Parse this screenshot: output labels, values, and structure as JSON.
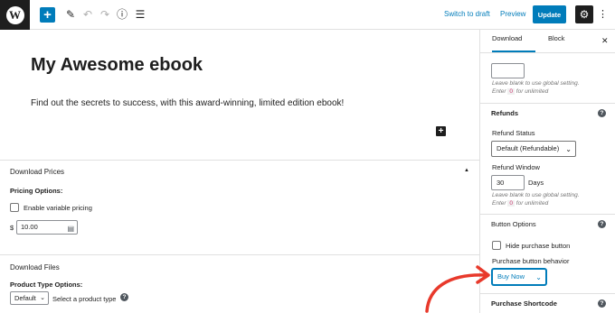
{
  "toolbar": {
    "logo_letter": "W",
    "switch_draft": "Switch to draft",
    "preview": "Preview",
    "update": "Update"
  },
  "editor": {
    "title": "My Awesome ebook",
    "paragraph": "Find out the secrets to success, with this award-winning, limited edition ebook!"
  },
  "download_prices": {
    "heading": "Download Prices",
    "pricing_options_label": "Pricing Options:",
    "variable_pricing_label": "Enable variable pricing",
    "currency_symbol": "$",
    "price_value": "10.00"
  },
  "download_files": {
    "heading": "Download Files",
    "product_type_label": "Product Type Options:",
    "product_type_selected": "Default",
    "product_type_hint": "Select a product type"
  },
  "sidebar": {
    "tabs": [
      "Download",
      "Block"
    ],
    "leave_blank_hint": "Leave blank to use global setting.",
    "enter_prefix": "Enter",
    "zero_code": "0",
    "unlimited_suffix": "for unlimited",
    "refunds": {
      "heading": "Refunds",
      "status_label": "Refund Status",
      "status_selected": "Default (Refundable)",
      "window_label": "Refund Window",
      "window_value": "30",
      "window_unit": "Days"
    },
    "button_options": {
      "heading": "Button Options",
      "hide_label": "Hide purchase button",
      "behavior_label": "Purchase button behavior",
      "behavior_selected": "Buy Now"
    },
    "shortcode_heading": "Purchase Shortcode"
  },
  "colors": {
    "accent": "#007cba",
    "annotation_arrow": "#e8392b"
  }
}
